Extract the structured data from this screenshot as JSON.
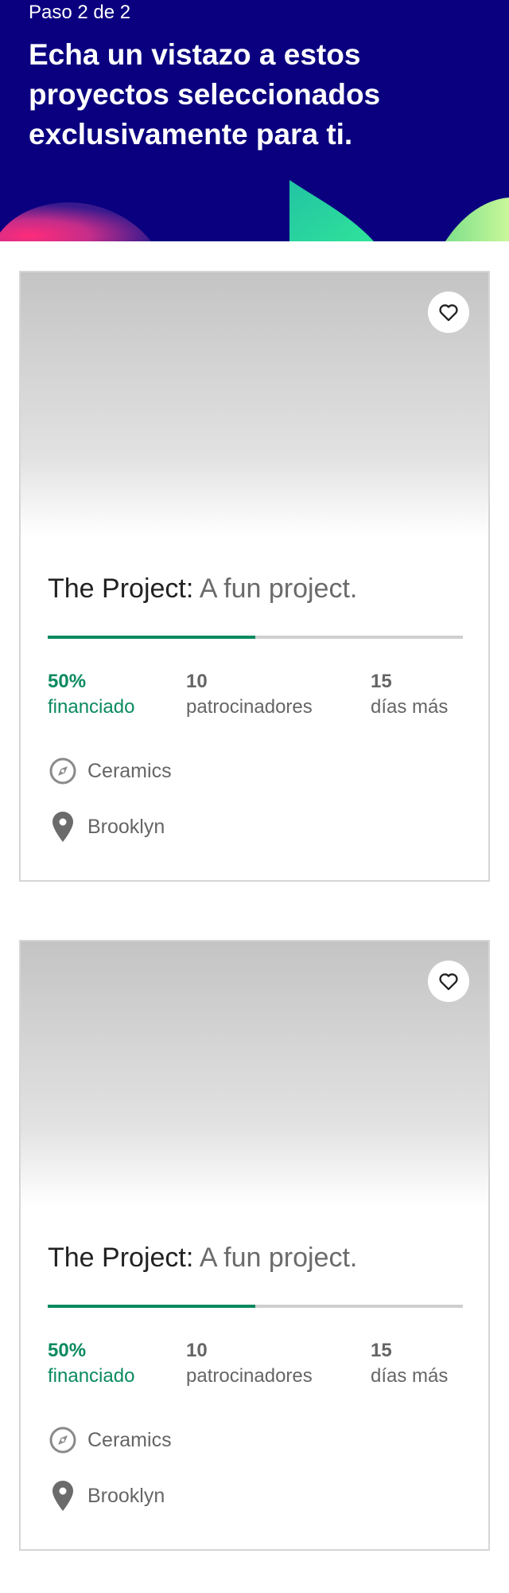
{
  "header": {
    "step": "Paso 2 de 2",
    "headline": "Echa un vistazo a estos proyectos seleccionados exclusivamente para ti."
  },
  "colors": {
    "header_bg": "#0a007f",
    "accent_green": "#0b8a5f",
    "track_gray": "#cfcfcf"
  },
  "icons": {
    "favorite": "heart-icon",
    "category": "compass-icon",
    "location": "map-pin-icon"
  },
  "projects": [
    {
      "name": "The Project:",
      "blurb": "A fun project.",
      "funded_fraction": 0.5,
      "funded_value": "50%",
      "funded_label": "financiado",
      "backers_value": "10",
      "backers_label": "patrocinadores",
      "days_value": "15",
      "days_label": "días más",
      "category": "Ceramics",
      "location": "Brooklyn"
    },
    {
      "name": "The Project:",
      "blurb": "A fun project.",
      "funded_fraction": 0.5,
      "funded_value": "50%",
      "funded_label": "financiado",
      "backers_value": "10",
      "backers_label": "patrocinadores",
      "days_value": "15",
      "days_label": "días más",
      "category": "Ceramics",
      "location": "Brooklyn"
    }
  ]
}
